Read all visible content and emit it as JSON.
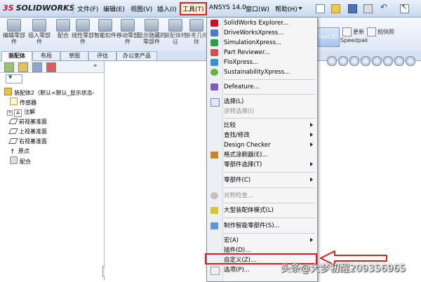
{
  "app": {
    "logo_ds": "3S",
    "logo_text": "SOLIDWORKS"
  },
  "menu": {
    "items": [
      "文件(F)",
      "编辑(E)",
      "视图(V)",
      "插入(I)",
      "工具(T)",
      "ANSYS 14.0",
      "窗口(W)",
      "帮助(H)"
    ],
    "active_index": 4
  },
  "ribbon": {
    "buttons": [
      "编辑零部件",
      "插入零部件",
      "配合",
      "线性零部件",
      "智能扣件",
      "移动零部件",
      "显示隐藏的零部件",
      "装配体特征",
      "参考几何体"
    ],
    "instant3d": "tant3D",
    "speedpak_label": "更新",
    "speedpak_sub": "Speedpak",
    "snapshot_label": "拍快照"
  },
  "tabs": [
    "装配体",
    "布局",
    "草图",
    "评估",
    "办公室产品"
  ],
  "tree": {
    "root": "装配体2（默认<默认_显示状态-",
    "items": [
      "传感器",
      "注解",
      "前视基准面",
      "上视基准面",
      "右视基准面",
      "原点",
      "配合"
    ]
  },
  "dropdown": {
    "items": [
      {
        "label": "SolidWorks Explorer...",
        "icon": "solidworks-explorer-icon",
        "disabled": false,
        "submenu": false
      },
      {
        "label": "DriveWorksXpress...",
        "icon": "driveworks-icon",
        "disabled": false,
        "submenu": false
      },
      {
        "label": "SimulationXpress...",
        "icon": "simulation-icon",
        "disabled": false,
        "submenu": false
      },
      {
        "label": "Part Reviewer...",
        "icon": "part-reviewer-icon",
        "disabled": false,
        "submenu": false
      },
      {
        "label": "FloXpress...",
        "icon": "floxpress-icon",
        "disabled": false,
        "submenu": false
      },
      {
        "label": "SustainabilityXpress...",
        "icon": "sustainability-icon",
        "disabled": false,
        "submenu": false
      },
      {
        "label": "Defeature...",
        "icon": "defeature-icon",
        "disabled": false,
        "submenu": false
      },
      {
        "label": "选择(L)",
        "icon": "select-icon",
        "disabled": false,
        "submenu": false
      },
      {
        "label": "逆转选择(I)",
        "icon": "",
        "disabled": true,
        "submenu": false
      },
      {
        "label": "比较",
        "icon": "",
        "disabled": false,
        "submenu": true
      },
      {
        "label": "查找/修改",
        "icon": "",
        "disabled": false,
        "submenu": true
      },
      {
        "label": "Design Checker",
        "icon": "",
        "disabled": false,
        "submenu": true
      },
      {
        "label": "格式涂刷器(E)...",
        "icon": "format-painter-icon",
        "disabled": false,
        "submenu": false
      },
      {
        "label": "零部件选择(T)",
        "icon": "",
        "disabled": false,
        "submenu": true
      },
      {
        "label": "零部件(C)",
        "icon": "",
        "disabled": false,
        "submenu": true
      },
      {
        "label": "对称检查...",
        "icon": "symmetry-check-icon",
        "disabled": true,
        "submenu": false
      },
      {
        "label": "大型装配体模式(L)",
        "icon": "large-assembly-icon",
        "disabled": false,
        "submenu": false
      },
      {
        "label": "制作智能零部件(S)...",
        "icon": "smart-component-icon",
        "disabled": false,
        "submenu": false
      },
      {
        "label": "宏(A)",
        "icon": "",
        "disabled": false,
        "submenu": true
      },
      {
        "label": "插件(D)...",
        "icon": "",
        "disabled": false,
        "submenu": false
      },
      {
        "label": "自定义(Z)...",
        "icon": "",
        "disabled": false,
        "submenu": false
      },
      {
        "label": "选项(P)...",
        "icon": "options-icon",
        "disabled": false,
        "submenu": false
      }
    ]
  },
  "watermark": "头条@大梦初醒209356965",
  "colors": {
    "highlight_red": "#d92020",
    "menubar_bg": "#c7d8ee"
  }
}
